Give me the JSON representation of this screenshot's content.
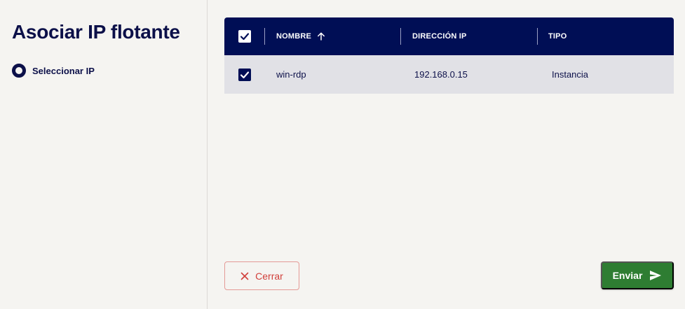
{
  "dialog": {
    "title": "Asociar IP flotante",
    "steps": [
      {
        "label": "Seleccionar IP",
        "state": "active"
      }
    ]
  },
  "table": {
    "columns": [
      {
        "key": "nombre",
        "label": "NOMBRE",
        "sort": "ascending"
      },
      {
        "key": "direccion",
        "label": "DIRECCIÓN IP"
      },
      {
        "key": "tipo",
        "label": "TIPO"
      }
    ],
    "select_all_checked": true,
    "rows": [
      {
        "checked": true,
        "nombre": "win-rdp",
        "direccion": "192.168.0.15",
        "tipo": "Instancia"
      }
    ]
  },
  "footer": {
    "close_label": "Cerrar",
    "send_label": "Enviar"
  },
  "colors": {
    "navy": "#000e55",
    "close_red": "#d1403b",
    "send_green": "#2e7d32",
    "row_bg": "#e1e1e6"
  }
}
